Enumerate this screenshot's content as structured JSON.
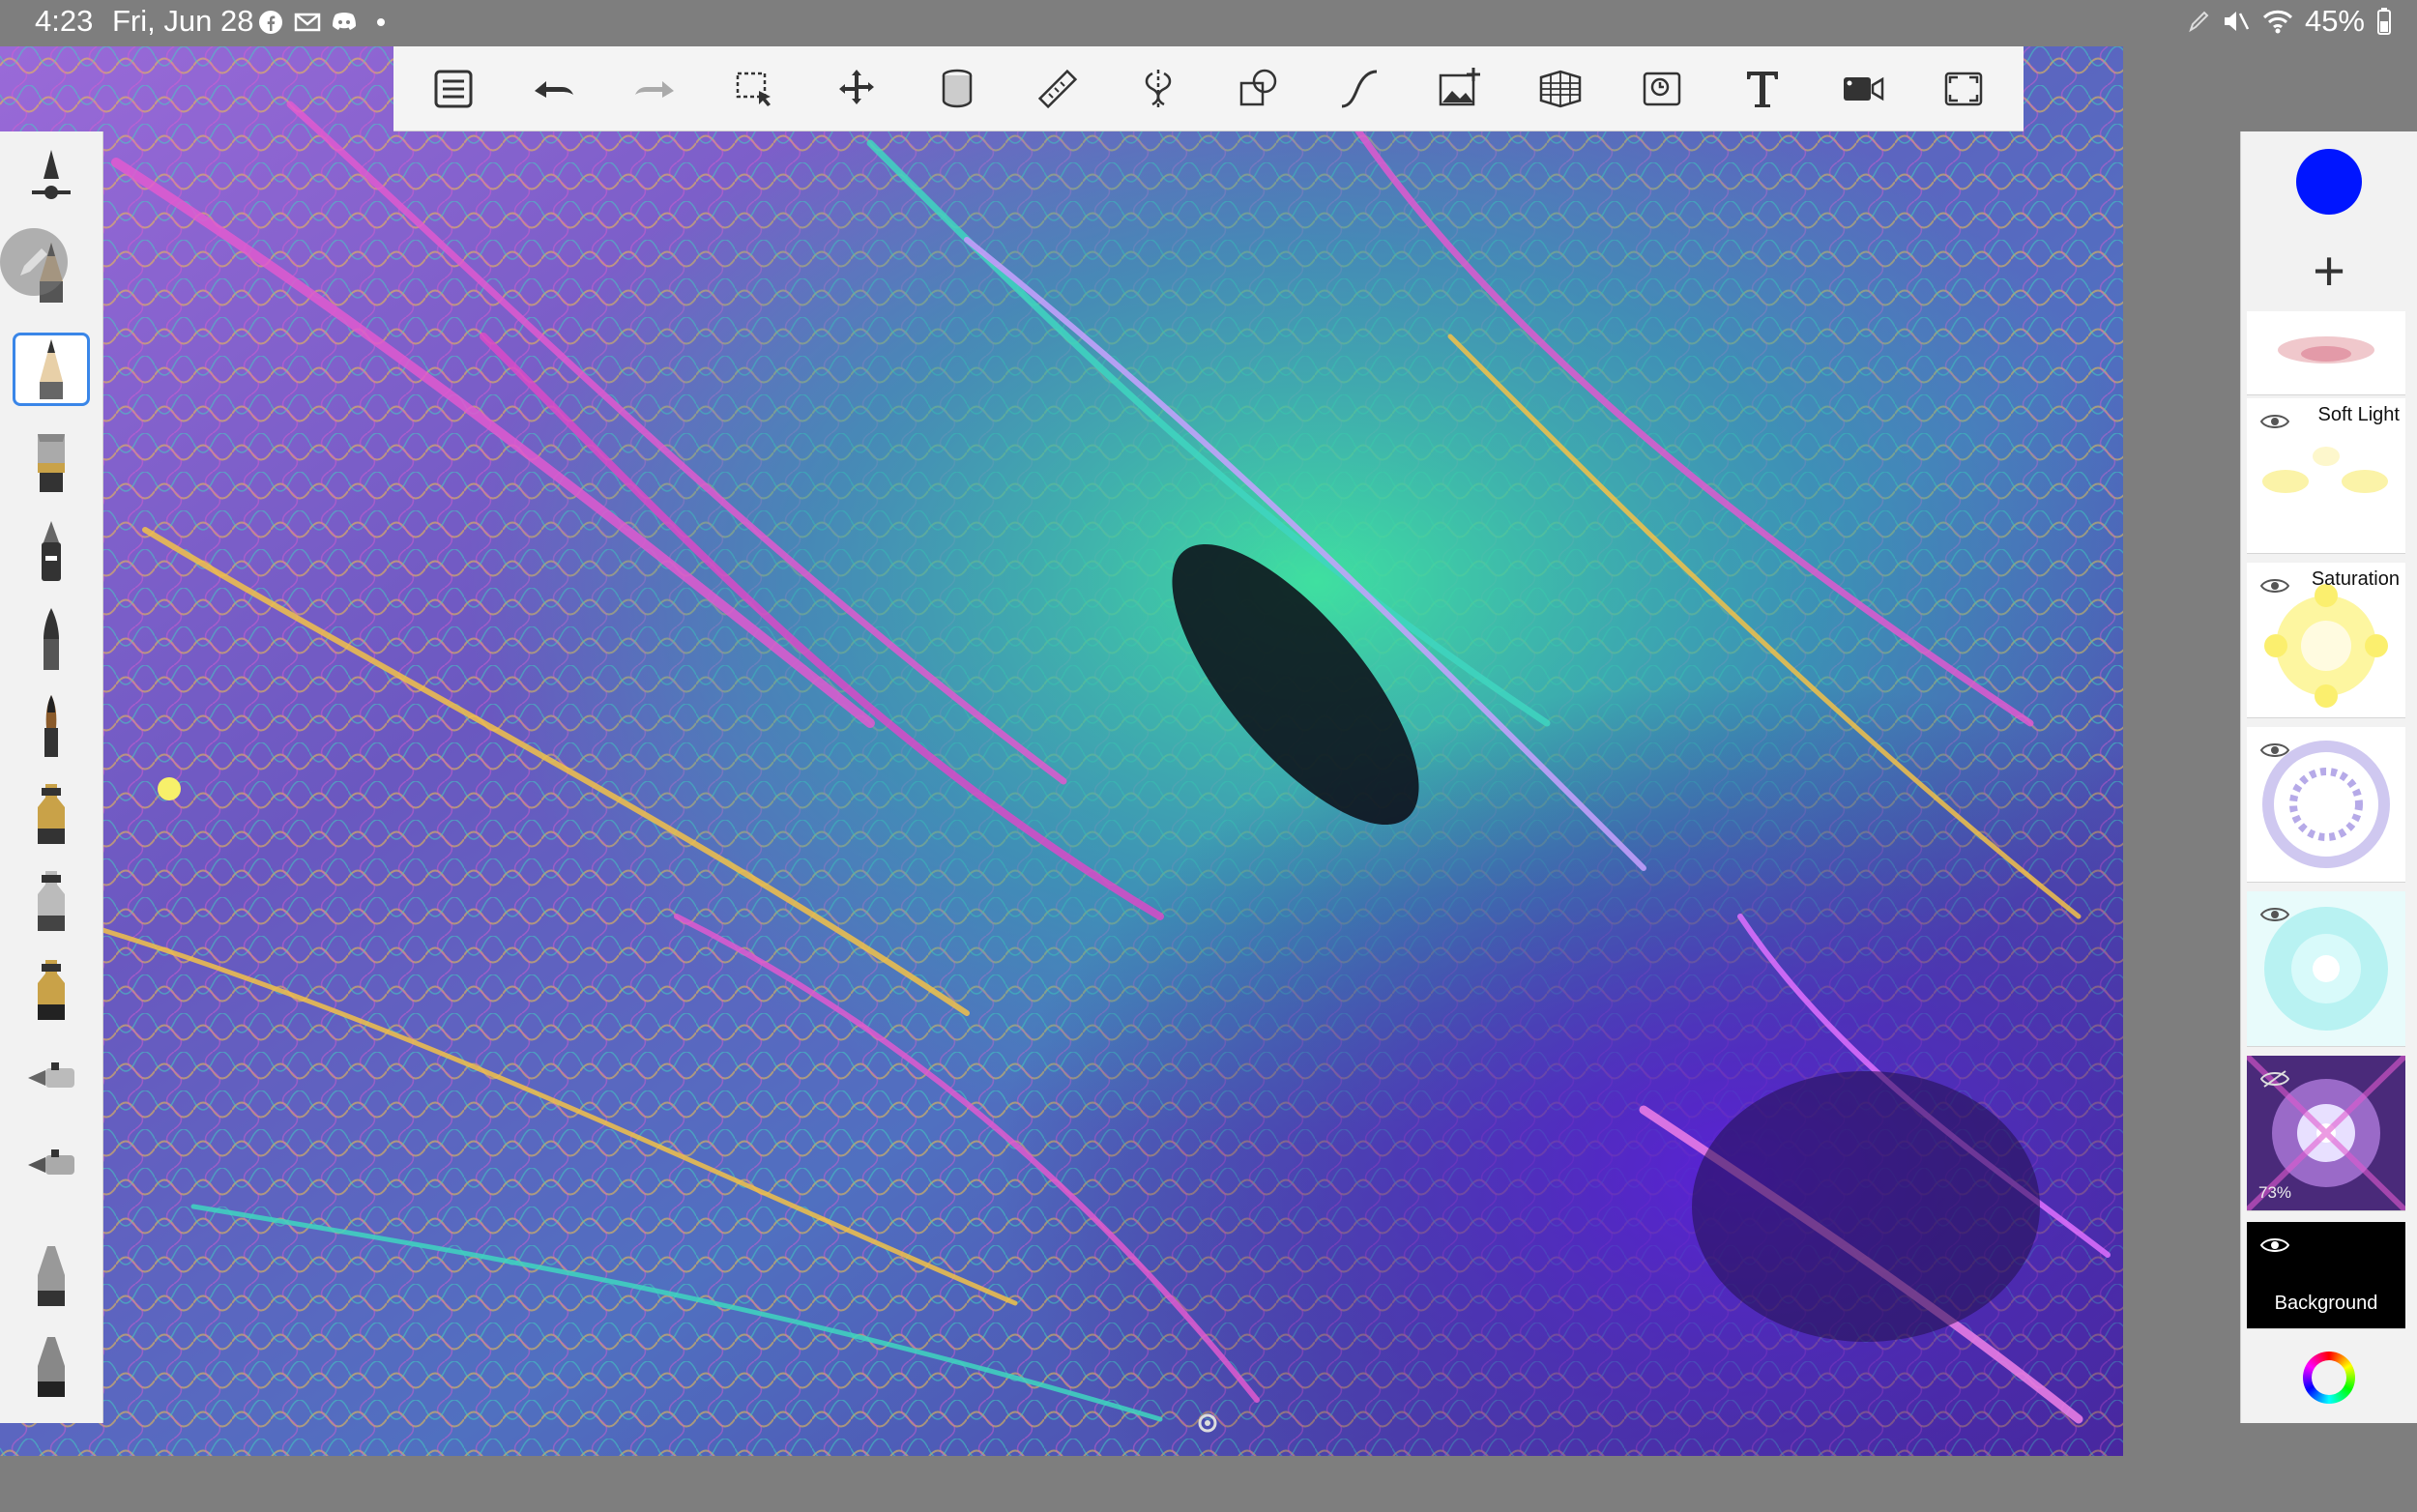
{
  "status_bar": {
    "time": "4:23",
    "date": "Fri, Jun 28",
    "app_icons": [
      "facebook-icon",
      "gmail-icon",
      "discord-icon",
      "dot-icon"
    ],
    "battery_percent": "45%",
    "system_icons": [
      "pen-icon",
      "mute-icon",
      "wifi-icon",
      "battery-icon"
    ]
  },
  "toolbar": {
    "items": [
      "menu-list-icon",
      "undo-icon",
      "redo-icon",
      "selection-icon",
      "transform-icon",
      "fill-bucket-icon",
      "ruler-icon",
      "symmetry-icon",
      "shapes-icon",
      "curve-icon",
      "image-add-icon",
      "perspective-grid-icon",
      "time-lapse-icon",
      "text-icon",
      "video-record-icon",
      "fullscreen-icon"
    ]
  },
  "brush_panel": {
    "selected_index": 2,
    "brushes": [
      "brush-settings-icon",
      "pencil-brush-icon",
      "pencil-brush-icon",
      "flat-brush-icon",
      "marker-brush-icon",
      "ink-brush-icon",
      "calligraphy-brush-icon",
      "airbrush-icon",
      "airbrush-icon",
      "airbrush-icon",
      "spray-brush-icon",
      "spray-brush-icon",
      "airbrush-icon",
      "airbrush-icon"
    ]
  },
  "layers_panel": {
    "current_color": "#0015ff",
    "layers": [
      {
        "mode": "",
        "visible": true,
        "opacity": "",
        "thumb": "pink-pattern"
      },
      {
        "mode": "Soft Light",
        "visible": true,
        "opacity": "",
        "thumb": "yellow-glow"
      },
      {
        "mode": "Saturation",
        "visible": true,
        "opacity": "",
        "thumb": "yellow-mandala"
      },
      {
        "mode": "",
        "visible": true,
        "opacity": "",
        "thumb": "lavender-mandala"
      },
      {
        "mode": "",
        "visible": true,
        "opacity": "",
        "thumb": "cyan-mandala"
      },
      {
        "mode": "",
        "visible": false,
        "opacity": "73%",
        "thumb": "dark-mandala"
      }
    ],
    "background_layer": {
      "name": "Background",
      "visible": true
    }
  },
  "colors": {
    "toolbar_bg": "#f4f4f4",
    "selection_blue": "#3a86e8",
    "canvas_palette": [
      "#6a3fb0",
      "#e05ad0",
      "#3fd6c0",
      "#f2c14a",
      "#2a2470"
    ]
  }
}
